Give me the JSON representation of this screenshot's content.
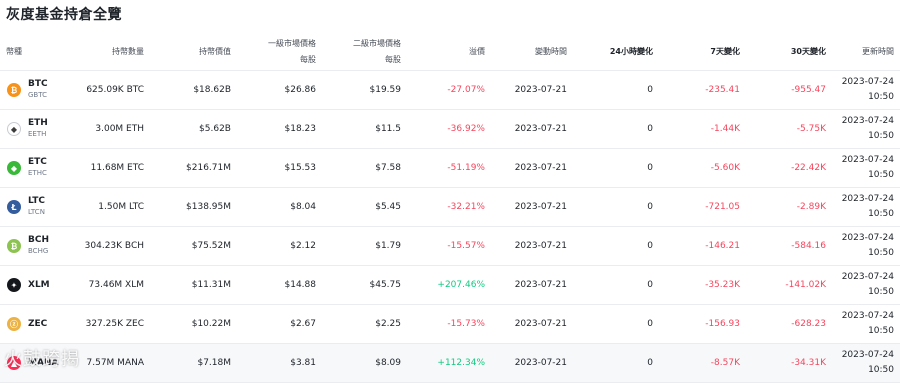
{
  "page": {
    "title": "灰度基金持倉全覽"
  },
  "table": {
    "headers": {
      "coin": "幣種",
      "holdings": "持幣數量",
      "holdings_value": "持幣價值",
      "secondary_price": "一級市場價格",
      "secondary_price_sub": "每股",
      "secondary_market": "二級市場價格",
      "secondary_market_sub": "每股",
      "premium": "溢價",
      "update_date": "變動時間",
      "change_24h": "24小時變化",
      "change_7d": "7天變化",
      "change_30d": "30天變化",
      "updated_at": "更新時間"
    },
    "rows": [
      {
        "symbol": "BTC",
        "trust": "GBTC",
        "icon": "btc-icon",
        "icon_glyph": "₿",
        "icon_color": "#f7931a",
        "holdings": "625.09K BTC",
        "value": "$18.62B",
        "nav": "$26.86",
        "market": "$19.59",
        "premium": "-27.07%",
        "premium_sign": "neg",
        "date": "2023-07-21",
        "d24": "0",
        "d7": "-235.41",
        "d30": "-955.47",
        "upd_date": "2023-07-24",
        "upd_time": "10:50"
      },
      {
        "symbol": "ETH",
        "trust": "EETH",
        "icon": "eth-icon",
        "icon_glyph": "◆",
        "icon_color": "#ffffff",
        "holdings": "3.00M ETH",
        "value": "$5.62B",
        "nav": "$18.23",
        "market": "$11.5",
        "premium": "-36.92%",
        "premium_sign": "neg",
        "date": "2023-07-21",
        "d24": "0",
        "d7": "-1.44K",
        "d30": "-5.75K",
        "upd_date": "2023-07-24",
        "upd_time": "10:50"
      },
      {
        "symbol": "ETC",
        "trust": "ETHC",
        "icon": "etc-icon",
        "icon_glyph": "◆",
        "icon_color": "#3ab83a",
        "holdings": "11.68M ETC",
        "value": "$216.71M",
        "nav": "$15.53",
        "market": "$7.58",
        "premium": "-51.19%",
        "premium_sign": "neg",
        "date": "2023-07-21",
        "d24": "0",
        "d7": "-5.60K",
        "d30": "-22.42K",
        "upd_date": "2023-07-24",
        "upd_time": "10:50"
      },
      {
        "symbol": "LTC",
        "trust": "LTCN",
        "icon": "ltc-icon",
        "icon_glyph": "Ł",
        "icon_color": "#345d9d",
        "holdings": "1.50M LTC",
        "value": "$138.95M",
        "nav": "$8.04",
        "market": "$5.45",
        "premium": "-32.21%",
        "premium_sign": "neg",
        "date": "2023-07-21",
        "d24": "0",
        "d7": "-721.05",
        "d30": "-2.89K",
        "upd_date": "2023-07-24",
        "upd_time": "10:50"
      },
      {
        "symbol": "BCH",
        "trust": "BCHG",
        "icon": "bch-icon",
        "icon_glyph": "₿",
        "icon_color": "#8dc351",
        "holdings": "304.23K BCH",
        "value": "$75.52M",
        "nav": "$2.12",
        "market": "$1.79",
        "premium": "-15.57%",
        "premium_sign": "neg",
        "date": "2023-07-21",
        "d24": "0",
        "d7": "-146.21",
        "d30": "-584.16",
        "upd_date": "2023-07-24",
        "upd_time": "10:50"
      },
      {
        "symbol": "XLM",
        "trust": "",
        "icon": "xlm-icon",
        "icon_glyph": "✦",
        "icon_color": "#14181d",
        "holdings": "73.46M XLM",
        "value": "$11.31M",
        "nav": "$14.88",
        "market": "$45.75",
        "premium": "+207.46%",
        "premium_sign": "pos",
        "date": "2023-07-21",
        "d24": "0",
        "d7": "-35.23K",
        "d30": "-141.02K",
        "upd_date": "2023-07-24",
        "upd_time": "10:50"
      },
      {
        "symbol": "ZEC",
        "trust": "",
        "icon": "zec-icon",
        "icon_glyph": "ⓩ",
        "icon_color": "#ecb244",
        "holdings": "327.25K ZEC",
        "value": "$10.22M",
        "nav": "$2.67",
        "market": "$2.25",
        "premium": "-15.73%",
        "premium_sign": "neg",
        "date": "2023-07-21",
        "d24": "0",
        "d7": "-156.93",
        "d30": "-628.23",
        "upd_date": "2023-07-24",
        "upd_time": "10:50"
      },
      {
        "symbol": "MANA",
        "trust": "",
        "icon": "mana-icon",
        "icon_glyph": "▲",
        "icon_color": "#ff2d55",
        "holdings": "7.57M MANA",
        "value": "$7.18M",
        "nav": "$3.81",
        "market": "$8.09",
        "premium": "+112.34%",
        "premium_sign": "pos",
        "date": "2023-07-21",
        "d24": "0",
        "d7": "-8.57K",
        "d30": "-34.31K",
        "upd_date": "2023-07-24",
        "upd_time": "10:50"
      }
    ]
  },
  "watermark": {
    "text": "火鼓跨揭"
  }
}
